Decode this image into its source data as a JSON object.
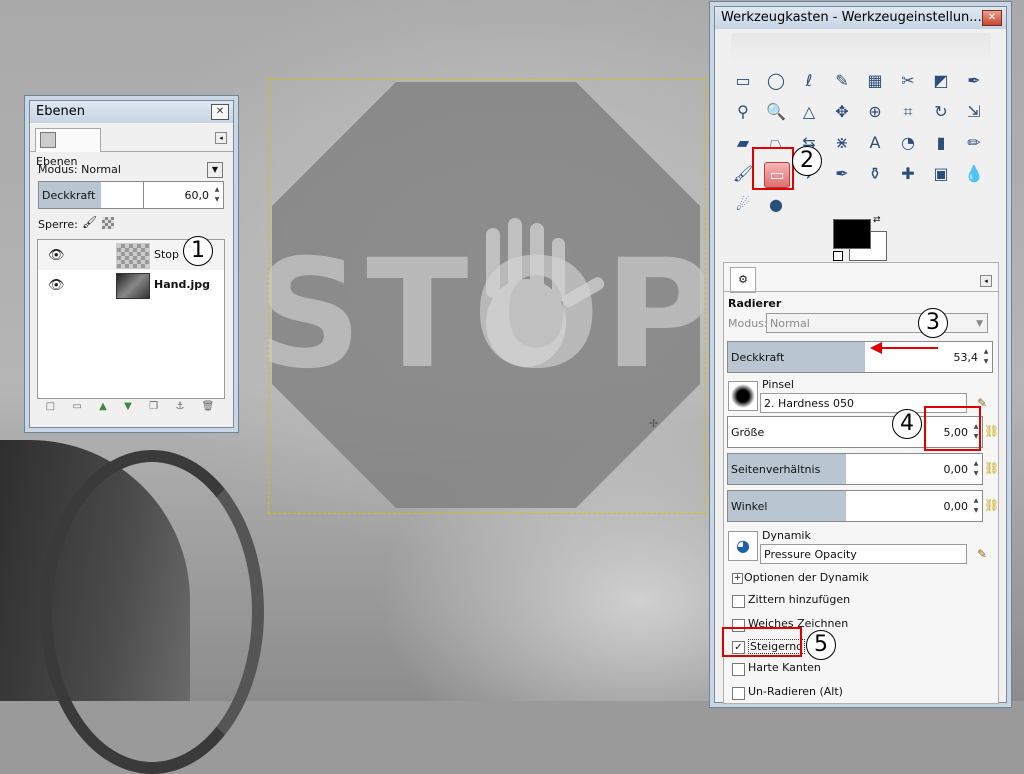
{
  "canvas": {
    "sign_text": "STOP"
  },
  "ebenen_dialog": {
    "title": "Ebenen",
    "close_glyph": "✕",
    "tab_label": "Ebenen",
    "tab_icon": "layers-icon",
    "modus_label": "Modus: Normal",
    "deckkraft_label": "Deckkraft",
    "deckkraft_value": "60,0",
    "deckkraft_fraction": 0.6,
    "sperre_label": "Sperre:",
    "layers": [
      {
        "name": "Stop",
        "visible": true,
        "selected": true
      },
      {
        "name": "Hand.jpg",
        "visible": true,
        "selected": false
      }
    ],
    "bottom_icons": [
      "new-layer-icon",
      "new-group-icon",
      "raise-icon",
      "lower-icon",
      "duplicate-icon",
      "anchor-icon",
      "delete-icon"
    ]
  },
  "toolbox": {
    "title": "Werkzeugkasten - Werkzeugeinstellun...",
    "close_glyph": "✕",
    "tools": [
      "rect-select-icon",
      "ellipse-select-icon",
      "lasso-icon",
      "fuzzy-select-icon",
      "color-select-icon",
      "scissors-icon",
      "foreground-select-icon",
      "paths-icon",
      "color-picker-icon",
      "zoom-icon",
      "measure-icon",
      "move-icon",
      "align-icon",
      "crop-icon",
      "rotate-icon",
      "scale-icon",
      "shear-icon",
      "perspective-icon",
      "flip-icon",
      "cage-icon",
      "text-icon",
      "bucket-fill-icon",
      "blend-icon",
      "pencil-icon",
      "paintbrush-icon",
      "eraser-icon",
      "airbrush-icon",
      "ink-icon",
      "clone-icon",
      "heal-icon",
      "perspective-clone-icon",
      "blur-icon",
      "smudge-icon",
      "dodge-burn-icon"
    ],
    "tool_glyphs": [
      "▭",
      "◯",
      "ℓ",
      "✎",
      "▦",
      "✂",
      "◩",
      "✒",
      "⚲",
      "🔍",
      "△",
      "✥",
      "⊕",
      "⌗",
      "↻",
      "⇲",
      "▰",
      "⏢",
      "⇆",
      "⋇",
      "A",
      "◔",
      "▮",
      "✏",
      "🖌",
      "▭",
      "✈",
      "✒",
      "⚱",
      "✚",
      "▣",
      "💧",
      "☄",
      "●"
    ],
    "tool_options": {
      "tool_name": "Radierer",
      "modus_label": "Modus:",
      "modus_value": "Normal",
      "deckkraft_label": "Deckkraft",
      "deckkraft_value": "53,4",
      "deckkraft_fraction": 0.534,
      "pinsel_label": "Pinsel",
      "pinsel_value": "2. Hardness 050",
      "groesse_label": "Größe",
      "groesse_value": "5,00",
      "seitenverhaeltnis_label": "Seitenverhältnis",
      "seitenverhaeltnis_value": "0,00",
      "winkel_label": "Winkel",
      "winkel_value": "0,00",
      "dynamik_label": "Dynamik",
      "dynamik_value": "Pressure Opacity",
      "checkboxes": [
        {
          "label": "Optionen der Dynamik",
          "checked": false,
          "expander": true
        },
        {
          "label": "Zittern hinzufügen",
          "checked": false
        },
        {
          "label": "Weiches Zeichnen",
          "checked": false
        },
        {
          "label": "Steigernd",
          "checked": true
        },
        {
          "label": "Harte Kanten",
          "checked": false
        },
        {
          "label": "Un-Radieren (Alt)",
          "checked": false
        }
      ]
    }
  },
  "annotations": {
    "numbers": [
      "1",
      "2",
      "3",
      "4",
      "5"
    ],
    "color": "#e00000"
  },
  "colors": {
    "fg": "#000000",
    "bg": "#ffffff",
    "slider_fill": "#b9c6d2",
    "marker": "#e00000",
    "selection": "#d4c200"
  }
}
